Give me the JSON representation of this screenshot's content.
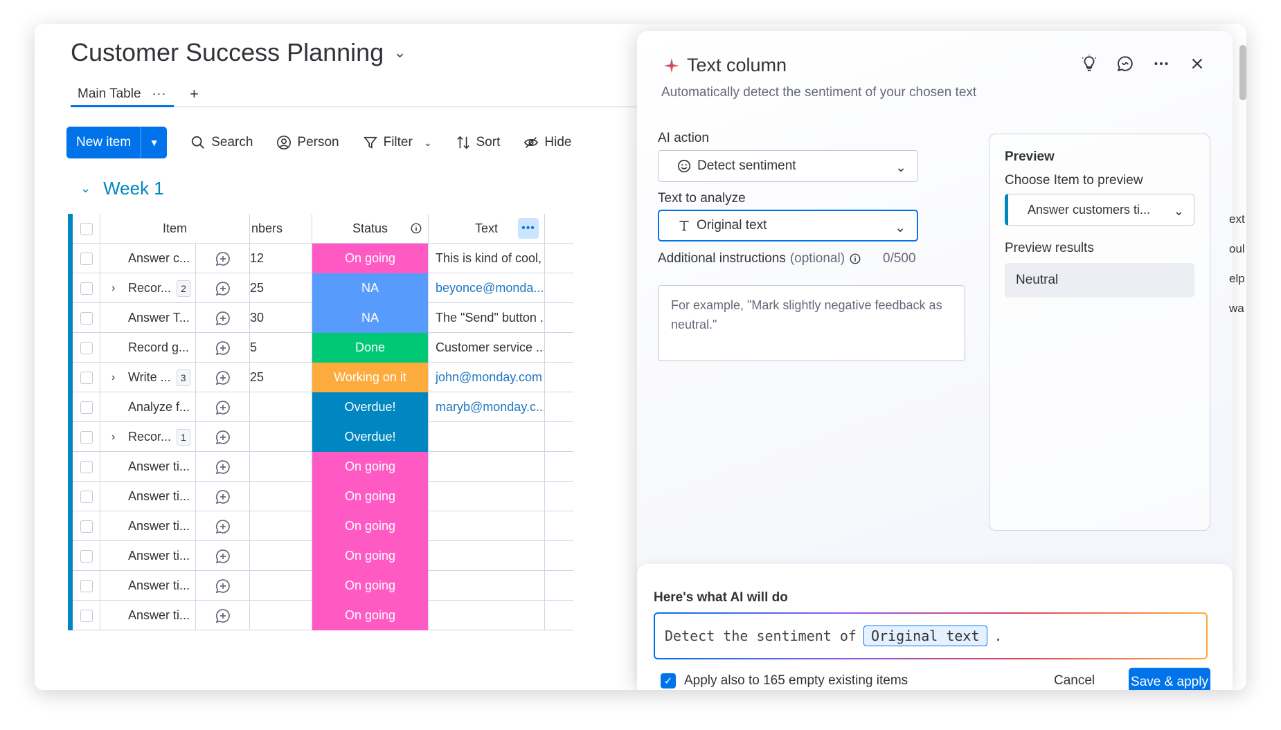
{
  "board": {
    "title": "Customer Success Planning",
    "tab_label": "Main Table",
    "tab_dots": "···",
    "tab_add": "+"
  },
  "toolbar": {
    "new_item": "New item",
    "search": "Search",
    "person": "Person",
    "filter": "Filter",
    "sort": "Sort",
    "hide": "Hide"
  },
  "group": {
    "title": "Week 1",
    "color": "#0086c0"
  },
  "table": {
    "headers": {
      "item": "Item",
      "numbers": "nbers",
      "status": "Status",
      "text": "Text"
    },
    "rows": [
      {
        "item": "Answer c...",
        "expand": false,
        "sub": "",
        "number": "12",
        "status": "On going",
        "status_color": "#ff5ac4",
        "text": "This is kind of cool, ...",
        "link": false
      },
      {
        "item": "Recor...",
        "expand": true,
        "sub": "2",
        "number": "25",
        "status": "NA",
        "status_color": "#579bfc",
        "text": "beyonce@monda...",
        "link": true
      },
      {
        "item": "Answer T...",
        "expand": false,
        "sub": "",
        "number": "30",
        "status": "NA",
        "status_color": "#579bfc",
        "text": "The \"Send\" button ...",
        "link": false
      },
      {
        "item": "Record g...",
        "expand": false,
        "sub": "",
        "number": "5",
        "status": "Done",
        "status_color": "#00c875",
        "text": "Customer service ...",
        "link": false
      },
      {
        "item": "Write ...",
        "expand": true,
        "sub": "3",
        "number": "25",
        "status": "Working on it",
        "status_color": "#fdab3d",
        "text": "john@monday.com",
        "link": true
      },
      {
        "item": "Analyze f...",
        "expand": false,
        "sub": "",
        "number": "",
        "status": "Overdue!",
        "status_color": "#0086c0",
        "text": "maryb@monday.c...",
        "link": true
      },
      {
        "item": "Recor...",
        "expand": true,
        "sub": "1",
        "number": "",
        "status": "Overdue!",
        "status_color": "#0086c0",
        "text": "",
        "link": false
      },
      {
        "item": "Answer ti...",
        "expand": false,
        "sub": "",
        "number": "",
        "status": "On going",
        "status_color": "#ff5ac4",
        "text": "",
        "link": false
      },
      {
        "item": "Answer ti...",
        "expand": false,
        "sub": "",
        "number": "",
        "status": "On going",
        "status_color": "#ff5ac4",
        "text": "",
        "link": false
      },
      {
        "item": "Answer ti...",
        "expand": false,
        "sub": "",
        "number": "",
        "status": "On going",
        "status_color": "#ff5ac4",
        "text": "",
        "link": false
      },
      {
        "item": "Answer ti...",
        "expand": false,
        "sub": "",
        "number": "",
        "status": "On going",
        "status_color": "#ff5ac4",
        "text": "",
        "link": false
      },
      {
        "item": "Answer ti...",
        "expand": false,
        "sub": "",
        "number": "",
        "status": "On going",
        "status_color": "#ff5ac4",
        "text": "",
        "link": false
      },
      {
        "item": "Answer ti...",
        "expand": false,
        "sub": "",
        "number": "",
        "status": "On going",
        "status_color": "#ff5ac4",
        "text": "",
        "link": false
      }
    ]
  },
  "panel": {
    "title": "Text column",
    "subtitle": "Automatically detect the sentiment of your chosen text",
    "ai_action_label": "AI action",
    "ai_action_value": "Detect sentiment",
    "text_analyze_label": "Text to analyze",
    "text_analyze_value": "Original text",
    "instructions_label": "Additional instructions",
    "instructions_optional": "(optional)",
    "instructions_counter": "0/500",
    "instructions_placeholder": "For example, \"Mark slightly negative feedback as neutral.\"",
    "preview": {
      "title": "Preview",
      "choose_label": "Choose Item to preview",
      "choose_value": "Answer customers ti...",
      "results_label": "Preview results",
      "result_value": "Neutral"
    },
    "summary": {
      "title": "Here's what AI will do",
      "prefix": "Detect the sentiment of",
      "chip": "Original text",
      "suffix": "."
    },
    "apply_label": "Apply also to 165 empty existing items",
    "cancel": "Cancel",
    "save": "Save & apply"
  },
  "side_peek": [
    "ext",
    "oul",
    "elp",
    "wa"
  ],
  "colors": {
    "accent": "#0073ea"
  }
}
